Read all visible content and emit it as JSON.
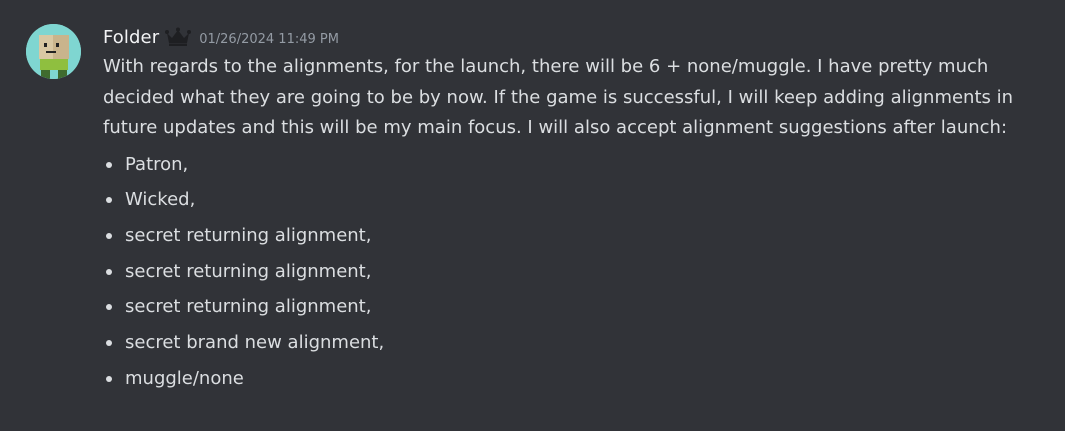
{
  "message": {
    "author": "Folder",
    "author_badge_icon": "crown-icon",
    "timestamp": "01/26/2024 11:49 PM",
    "body": "With regards to the alignments, for the launch, there will be 6 + none/muggle. I have pretty much decided what they are going to be by now. If the game is successful, I will keep adding alignments in future updates and this will be my main focus. I will also accept alignment suggestions after launch:",
    "bullets": [
      "Patron,",
      "Wicked,",
      "secret returning alignment,",
      "secret returning alignment,",
      "secret returning alignment,",
      "secret brand new alignment,",
      "muggle/none"
    ]
  },
  "colors": {
    "background": "#313338",
    "username": "#f2f3f5",
    "text": "#dbdee1",
    "timestamp": "#949ba4",
    "avatar_bg": "#7fd6d1"
  }
}
